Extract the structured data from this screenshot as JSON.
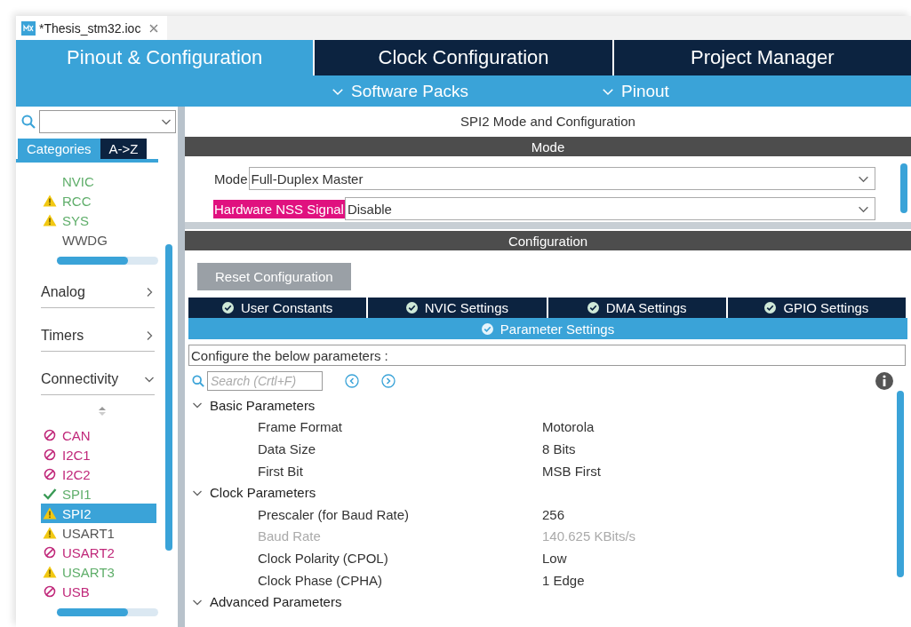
{
  "file_tab": {
    "title": "*Thesis_stm32.ioc"
  },
  "main_tabs": [
    {
      "label": "Pinout & Configuration",
      "selected": true
    },
    {
      "label": "Clock Configuration",
      "selected": false
    },
    {
      "label": "Project Manager",
      "selected": false
    }
  ],
  "sub_menu": [
    {
      "label": "Software Packs"
    },
    {
      "label": "Pinout"
    }
  ],
  "sidebar": {
    "category_tabs": [
      {
        "label": "Categories",
        "selected": true
      },
      {
        "label": "A->Z",
        "selected": false
      }
    ],
    "system_items": [
      {
        "label": "NVIC",
        "kind": "plain",
        "color": "#5fae6a"
      },
      {
        "label": "RCC",
        "kind": "warning",
        "color": "#5fae6a"
      },
      {
        "label": "SYS",
        "kind": "warning",
        "color": "#5fae6a"
      },
      {
        "label": "WWDG",
        "kind": "plain",
        "color": "#555555"
      }
    ],
    "categories": [
      {
        "label": "Analog",
        "expanded": false
      },
      {
        "label": "Timers",
        "expanded": false
      },
      {
        "label": "Connectivity",
        "expanded": true,
        "children": [
          {
            "label": "CAN",
            "kind": "blocked",
            "color": "#c0287a",
            "selected": false
          },
          {
            "label": "I2C1",
            "kind": "blocked",
            "color": "#c0287a",
            "selected": false
          },
          {
            "label": "I2C2",
            "kind": "blocked",
            "color": "#c0287a",
            "selected": false
          },
          {
            "label": "SPI1",
            "kind": "ok",
            "color": "#5fae6a",
            "selected": false
          },
          {
            "label": "SPI2",
            "kind": "warning",
            "selected": true
          },
          {
            "label": "USART1",
            "kind": "warning",
            "color": "#555555",
            "selected": false
          },
          {
            "label": "USART2",
            "kind": "blocked",
            "color": "#c0287a",
            "selected": false
          },
          {
            "label": "USART3",
            "kind": "warning",
            "color": "#5fae6a",
            "selected": false
          },
          {
            "label": "USB",
            "kind": "blocked",
            "color": "#c0287a",
            "selected": false
          }
        ]
      }
    ]
  },
  "panel": {
    "title": "SPI2 Mode and Configuration",
    "mode_section": {
      "title": "Mode",
      "fields": [
        {
          "label": "Mode",
          "value": "Full-Duplex Master",
          "highlighted": false
        },
        {
          "label": "Hardware NSS Signal",
          "value": "Disable",
          "highlighted": true
        }
      ]
    },
    "config_section": {
      "title": "Configuration",
      "reset_button": "Reset Configuration",
      "tabs": [
        {
          "label": "User Constants",
          "selected": false
        },
        {
          "label": "NVIC Settings",
          "selected": false
        },
        {
          "label": "DMA Settings",
          "selected": false
        },
        {
          "label": "GPIO Settings",
          "selected": false
        },
        {
          "label": "Parameter Settings",
          "selected": true
        }
      ],
      "description": "Configure the below parameters :",
      "search": {
        "placeholder": "Search (Crtl+F)"
      },
      "groups": [
        {
          "label": "Basic Parameters",
          "expanded": true,
          "params": [
            {
              "name": "Frame Format",
              "value": "Motorola",
              "disabled": false
            },
            {
              "name": "Data Size",
              "value": "8 Bits",
              "disabled": false
            },
            {
              "name": "First Bit",
              "value": "MSB First",
              "disabled": false
            }
          ]
        },
        {
          "label": "Clock Parameters",
          "expanded": true,
          "params": [
            {
              "name": "Prescaler (for Baud Rate)",
              "value": "256",
              "disabled": false
            },
            {
              "name": "Baud Rate",
              "value": "140.625 KBits/s",
              "disabled": true
            },
            {
              "name": "Clock Polarity (CPOL)",
              "value": "Low",
              "disabled": false
            },
            {
              "name": "Clock Phase (CPHA)",
              "value": "1 Edge",
              "disabled": false
            }
          ]
        },
        {
          "label": "Advanced Parameters",
          "expanded": true
        }
      ]
    }
  }
}
